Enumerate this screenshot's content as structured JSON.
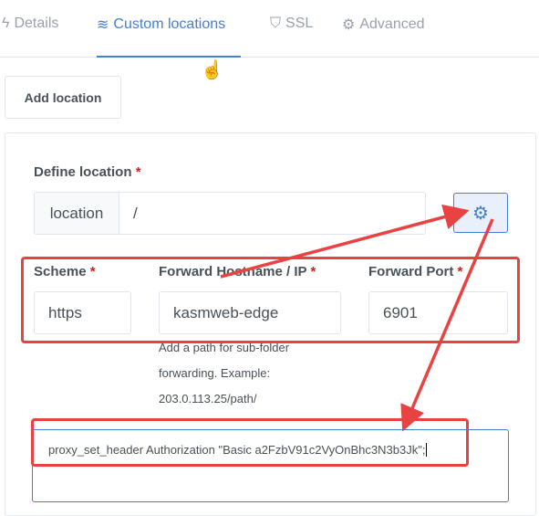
{
  "tabs": [
    {
      "label": "Details",
      "icon": "bolt-icon"
    },
    {
      "label": "Custom locations",
      "icon": "layers-icon",
      "active": true
    },
    {
      "label": "SSL",
      "icon": "shield-icon"
    },
    {
      "label": "Advanced",
      "icon": "gear-icon"
    }
  ],
  "add_location_label": "Add location",
  "form": {
    "define_location_label": "Define location",
    "required_mark": "*",
    "location_addon": "location",
    "location_value": "/",
    "scheme_label": "Scheme",
    "scheme_value": "https",
    "hostname_label": "Forward Hostname / IP",
    "hostname_value": "kasmweb-edge",
    "port_label": "Forward Port",
    "port_value": "6901",
    "help_lines": [
      "Add a path for sub-folder",
      "forwarding. Example:",
      "203.0.113.25/path/"
    ],
    "advanced_config": "proxy_set_header Authorization \"Basic a2FzbV91c2VyOnBhc3N3b3Jk\";"
  },
  "colors": {
    "accent": "#467fcf",
    "annotation": "#e84242",
    "required": "#cd201f"
  }
}
